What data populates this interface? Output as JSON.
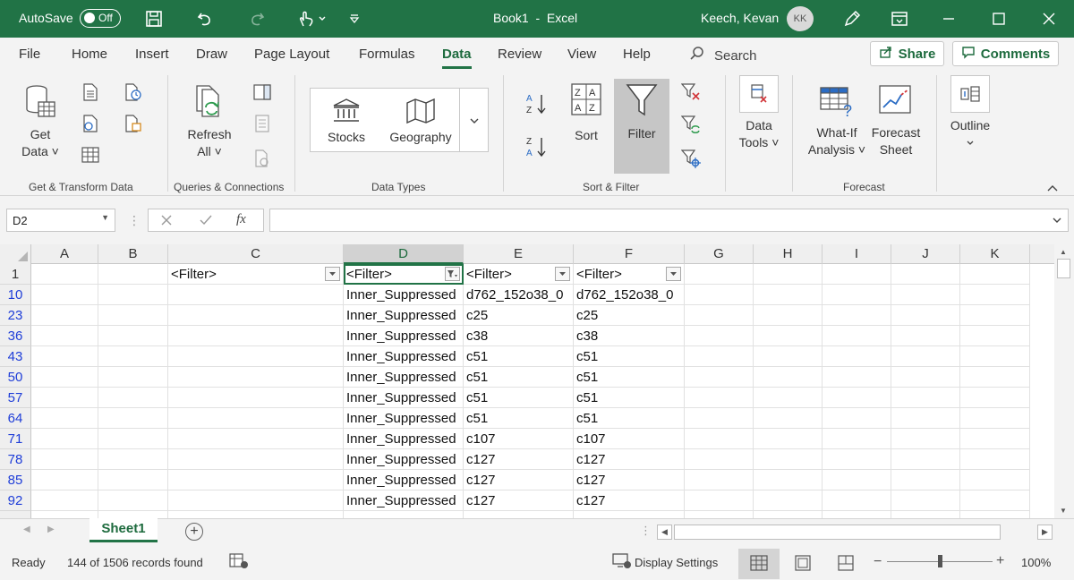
{
  "titlebar": {
    "autosave_label": "AutoSave",
    "autosave_state": "Off",
    "doc_title": "Book1  -  Excel",
    "user_name": "Keech, Kevan",
    "user_initials": "KK"
  },
  "tabs": {
    "items": [
      "File",
      "Home",
      "Insert",
      "Draw",
      "Page Layout",
      "Formulas",
      "Data",
      "Review",
      "View",
      "Help"
    ],
    "active": "Data",
    "search_label": "Search",
    "share_label": "Share",
    "comments_label": "Comments"
  },
  "ribbon": {
    "get_data_line1": "Get",
    "get_data_line2": "Data ˅",
    "refresh_line1": "Refresh",
    "refresh_line2": "All ˅",
    "stocks": "Stocks",
    "geography": "Geography",
    "sort": "Sort",
    "filter": "Filter",
    "data_tools_line1": "Data",
    "data_tools_line2": "Tools ˅",
    "whatif_line1": "What-If",
    "whatif_line2": "Analysis ˅",
    "forecast_line1": "Forecast",
    "forecast_line2": "Sheet",
    "outline": "Outline",
    "groups": {
      "get_transform": "Get & Transform Data",
      "queries": "Queries & Connections",
      "data_types": "Data Types",
      "sort_filter": "Sort & Filter",
      "forecast": "Forecast"
    }
  },
  "formula_bar": {
    "name_box": "D2",
    "fx": "fx",
    "value": ""
  },
  "grid": {
    "columns": [
      "A",
      "B",
      "C",
      "D",
      "E",
      "F",
      "G",
      "H",
      "I",
      "J",
      "K"
    ],
    "header_row_number": "1",
    "header_cells": {
      "C": "<Filter>",
      "D": "<Filter>",
      "E": "<Filter>",
      "F": "<Filter>"
    },
    "rows": [
      {
        "num": "10",
        "D": "Inner_Suppressed",
        "E": "d762_152o38_0",
        "F": "d762_152o38_0"
      },
      {
        "num": "23",
        "D": "Inner_Suppressed",
        "E": "c25",
        "F": "c25"
      },
      {
        "num": "36",
        "D": "Inner_Suppressed",
        "E": "c38",
        "F": "c38"
      },
      {
        "num": "43",
        "D": "Inner_Suppressed",
        "E": "c51",
        "F": "c51"
      },
      {
        "num": "50",
        "D": "Inner_Suppressed",
        "E": "c51",
        "F": "c51"
      },
      {
        "num": "57",
        "D": "Inner_Suppressed",
        "E": "c51",
        "F": "c51"
      },
      {
        "num": "64",
        "D": "Inner_Suppressed",
        "E": "c51",
        "F": "c51"
      },
      {
        "num": "71",
        "D": "Inner_Suppressed",
        "E": "c107",
        "F": "c107"
      },
      {
        "num": "78",
        "D": "Inner_Suppressed",
        "E": "c127",
        "F": "c127"
      },
      {
        "num": "85",
        "D": "Inner_Suppressed",
        "E": "c127",
        "F": "c127"
      },
      {
        "num": "92",
        "D": "Inner_Suppressed",
        "E": "c127",
        "F": "c127"
      }
    ]
  },
  "sheets": {
    "active": "Sheet1"
  },
  "status": {
    "ready": "Ready",
    "records": "144 of 1506 records found",
    "display_settings": "Display Settings",
    "zoom": "100%",
    "zoom_level": 100
  },
  "colors": {
    "brand": "#217346",
    "brand_text": "#1e6b3e",
    "filtered_row_number": "#1e3dd8"
  }
}
